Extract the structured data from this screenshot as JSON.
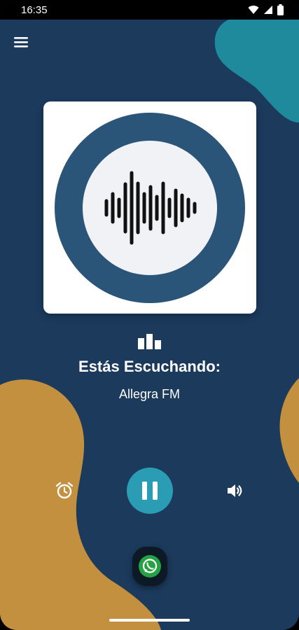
{
  "status_bar": {
    "time": "16:35",
    "icons": [
      "wifi-icon",
      "signal-icon",
      "battery-icon"
    ]
  },
  "colors": {
    "background": "#1b3a5c",
    "accent_teal": "#2a9db5",
    "blob_gold": "#c2903e",
    "blob_teal": "#1f8a9c",
    "logo_ring": "#2a5478",
    "logo_inner": "#f1f2f5"
  },
  "header": {
    "menu_icon": "hamburger-menu-icon"
  },
  "player": {
    "listening_label": "Estás Escuchando:",
    "station_name": "Allegra FM",
    "state": "playing"
  },
  "controls": {
    "alarm_icon": "alarm-clock-icon",
    "play_pause_icon": "pause-icon",
    "volume_icon": "volume-icon",
    "whatsapp_icon": "whatsapp-icon"
  }
}
